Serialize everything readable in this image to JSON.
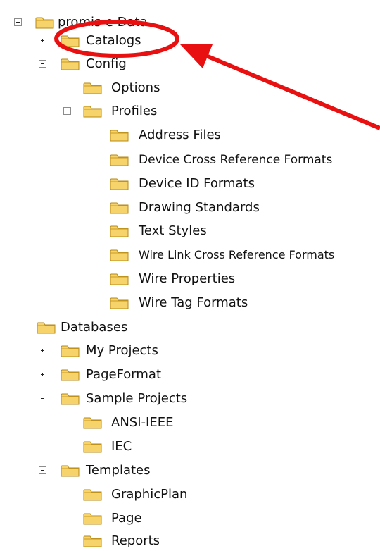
{
  "tree": {
    "root_label": "promis-e Data",
    "items": [
      {
        "label": "Catalogs",
        "state": "collapsed"
      },
      {
        "label": "Config",
        "state": "expanded"
      },
      {
        "label": "Options",
        "state": "leaf"
      },
      {
        "label": "Profiles",
        "state": "expanded"
      },
      {
        "label": "Address Files",
        "state": "leaf"
      },
      {
        "label": "Device Cross Reference Formats",
        "state": "leaf"
      },
      {
        "label": "Device ID Formats",
        "state": "leaf"
      },
      {
        "label": "Drawing Standards",
        "state": "leaf"
      },
      {
        "label": "Text Styles",
        "state": "leaf"
      },
      {
        "label": "Wire Link Cross Reference Formats",
        "state": "leaf"
      },
      {
        "label": "Wire Properties",
        "state": "leaf"
      },
      {
        "label": "Wire Tag Formats",
        "state": "leaf"
      },
      {
        "label": "Databases",
        "state": "leaf"
      },
      {
        "label": "My Projects",
        "state": "collapsed"
      },
      {
        "label": "PageFormat",
        "state": "collapsed"
      },
      {
        "label": "Sample Projects",
        "state": "expanded"
      },
      {
        "label": "ANSI-IEEE",
        "state": "leaf"
      },
      {
        "label": "IEC",
        "state": "leaf"
      },
      {
        "label": "Templates",
        "state": "expanded"
      },
      {
        "label": "GraphicPlan",
        "state": "leaf"
      },
      {
        "label": "Page",
        "state": "leaf"
      },
      {
        "label": "Reports",
        "state": "leaf"
      }
    ]
  },
  "annotation": {
    "highlight_color": "#e81010",
    "highlighted_item": "Catalogs"
  },
  "icons": {
    "folder": "folder-icon",
    "expand": "plus-box-icon",
    "collapse": "minus-box-icon"
  },
  "colors": {
    "folder_fill": "#f6d36b",
    "folder_stroke": "#b58a17"
  }
}
